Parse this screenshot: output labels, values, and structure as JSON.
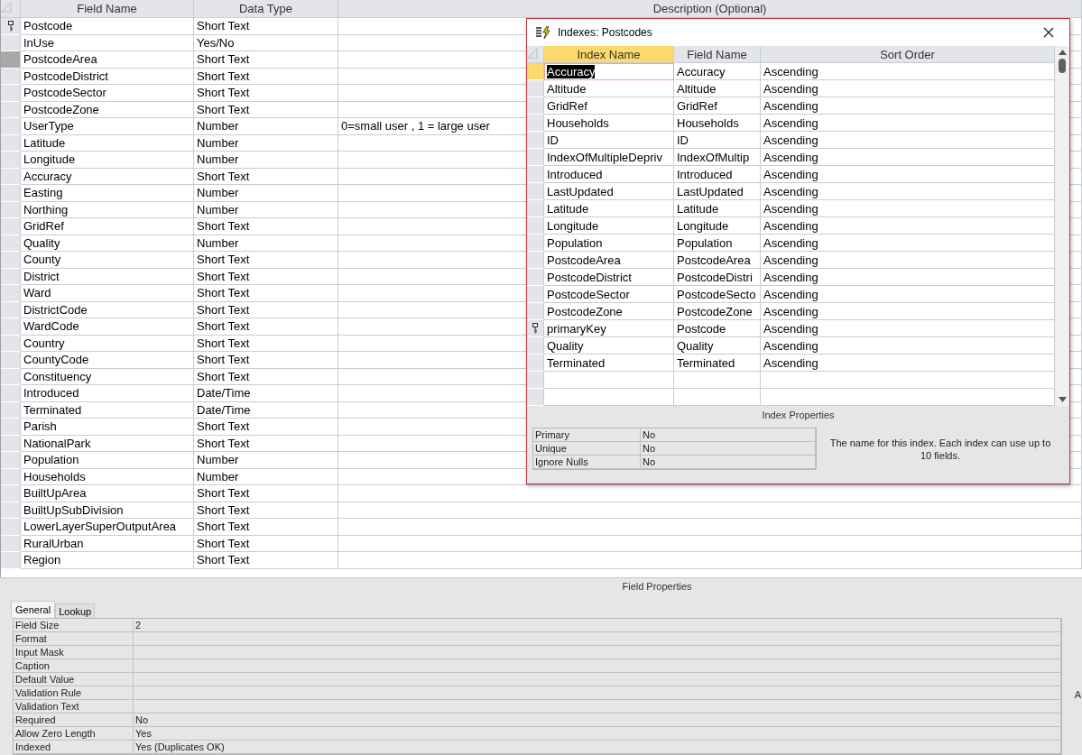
{
  "design_grid": {
    "columns": [
      "Field Name",
      "Data Type",
      "Description (Optional)"
    ],
    "rows": [
      {
        "name": "Postcode",
        "type": "Short Text",
        "description": "",
        "primary_key": true,
        "selected": false
      },
      {
        "name": "InUse",
        "type": "Yes/No",
        "description": "",
        "primary_key": false,
        "selected": false
      },
      {
        "name": "PostcodeArea",
        "type": "Short Text",
        "description": "",
        "primary_key": false,
        "selected": true
      },
      {
        "name": "PostcodeDistrict",
        "type": "Short Text",
        "description": "",
        "primary_key": false,
        "selected": false
      },
      {
        "name": "PostcodeSector",
        "type": "Short Text",
        "description": "",
        "primary_key": false,
        "selected": false
      },
      {
        "name": "PostcodeZone",
        "type": "Short Text",
        "description": "",
        "primary_key": false,
        "selected": false
      },
      {
        "name": "UserType",
        "type": "Number",
        "description": "0=small user ,  1 = large user",
        "primary_key": false,
        "selected": false
      },
      {
        "name": "Latitude",
        "type": "Number",
        "description": "",
        "primary_key": false,
        "selected": false
      },
      {
        "name": "Longitude",
        "type": "Number",
        "description": "",
        "primary_key": false,
        "selected": false
      },
      {
        "name": "Accuracy",
        "type": "Short Text",
        "description": "",
        "primary_key": false,
        "selected": false
      },
      {
        "name": "Easting",
        "type": "Number",
        "description": "",
        "primary_key": false,
        "selected": false
      },
      {
        "name": "Northing",
        "type": "Number",
        "description": "",
        "primary_key": false,
        "selected": false
      },
      {
        "name": "GridRef",
        "type": "Short Text",
        "description": "",
        "primary_key": false,
        "selected": false
      },
      {
        "name": "Quality",
        "type": "Number",
        "description": "",
        "primary_key": false,
        "selected": false
      },
      {
        "name": "County",
        "type": "Short Text",
        "description": "",
        "primary_key": false,
        "selected": false
      },
      {
        "name": "District",
        "type": "Short Text",
        "description": "",
        "primary_key": false,
        "selected": false
      },
      {
        "name": "Ward",
        "type": "Short Text",
        "description": "",
        "primary_key": false,
        "selected": false
      },
      {
        "name": "DistrictCode",
        "type": "Short Text",
        "description": "",
        "primary_key": false,
        "selected": false
      },
      {
        "name": "WardCode",
        "type": "Short Text",
        "description": "",
        "primary_key": false,
        "selected": false
      },
      {
        "name": "Country",
        "type": "Short Text",
        "description": "",
        "primary_key": false,
        "selected": false
      },
      {
        "name": "CountyCode",
        "type": "Short Text",
        "description": "",
        "primary_key": false,
        "selected": false
      },
      {
        "name": "Constituency",
        "type": "Short Text",
        "description": "",
        "primary_key": false,
        "selected": false
      },
      {
        "name": "Introduced",
        "type": "Date/Time",
        "description": "",
        "primary_key": false,
        "selected": false
      },
      {
        "name": "Terminated",
        "type": "Date/Time",
        "description": "",
        "primary_key": false,
        "selected": false
      },
      {
        "name": "Parish",
        "type": "Short Text",
        "description": "",
        "primary_key": false,
        "selected": false
      },
      {
        "name": "NationalPark",
        "type": "Short Text",
        "description": "",
        "primary_key": false,
        "selected": false
      },
      {
        "name": "Population",
        "type": "Number",
        "description": "",
        "primary_key": false,
        "selected": false
      },
      {
        "name": "Households",
        "type": "Number",
        "description": "",
        "primary_key": false,
        "selected": false
      },
      {
        "name": "BuiltUpArea",
        "type": "Short Text",
        "description": "",
        "primary_key": false,
        "selected": false
      },
      {
        "name": "BuiltUpSubDivision",
        "type": "Short Text",
        "description": "",
        "primary_key": false,
        "selected": false
      },
      {
        "name": "LowerLayerSuperOutputArea",
        "type": "Short Text",
        "description": "",
        "primary_key": false,
        "selected": false
      },
      {
        "name": "RuralUrban",
        "type": "Short Text",
        "description": "",
        "primary_key": false,
        "selected": false
      },
      {
        "name": "Region",
        "type": "Short Text",
        "description": "",
        "primary_key": false,
        "selected": false
      }
    ]
  },
  "field_properties": {
    "title": "Field Properties",
    "tabs": [
      {
        "label": "General",
        "selected": true
      },
      {
        "label": "Lookup",
        "selected": false
      }
    ],
    "rows": [
      {
        "label": "Field Size",
        "value": "2"
      },
      {
        "label": "Format",
        "value": ""
      },
      {
        "label": "Input Mask",
        "value": ""
      },
      {
        "label": "Caption",
        "value": ""
      },
      {
        "label": "Default Value",
        "value": ""
      },
      {
        "label": "Validation Rule",
        "value": ""
      },
      {
        "label": "Validation Text",
        "value": ""
      },
      {
        "label": "Required",
        "value": "No"
      },
      {
        "label": "Allow Zero Length",
        "value": "Yes"
      },
      {
        "label": "Indexed",
        "value": "Yes (Duplicates OK)"
      }
    ],
    "help_text": "A"
  },
  "indexes_dialog": {
    "title": "Indexes: Postcodes",
    "columns": [
      "Index Name",
      "Field Name",
      "Sort Order"
    ],
    "rows": [
      {
        "index_name": "Accuracy",
        "field_name": "Accuracy",
        "sort_order": "Ascending",
        "primary_key": false,
        "selected": true
      },
      {
        "index_name": "Altitude",
        "field_name": "Altitude",
        "sort_order": "Ascending",
        "primary_key": false,
        "selected": false
      },
      {
        "index_name": "GridRef",
        "field_name": "GridRef",
        "sort_order": "Ascending",
        "primary_key": false,
        "selected": false
      },
      {
        "index_name": "Households",
        "field_name": "Households",
        "sort_order": "Ascending",
        "primary_key": false,
        "selected": false
      },
      {
        "index_name": "ID",
        "field_name": "ID",
        "sort_order": "Ascending",
        "primary_key": false,
        "selected": false
      },
      {
        "index_name": "IndexOfMultipleDepriv",
        "field_name": "IndexOfMultip",
        "sort_order": "Ascending",
        "primary_key": false,
        "selected": false
      },
      {
        "index_name": "Introduced",
        "field_name": "Introduced",
        "sort_order": "Ascending",
        "primary_key": false,
        "selected": false
      },
      {
        "index_name": "LastUpdated",
        "field_name": "LastUpdated",
        "sort_order": "Ascending",
        "primary_key": false,
        "selected": false
      },
      {
        "index_name": "Latitude",
        "field_name": "Latitude",
        "sort_order": "Ascending",
        "primary_key": false,
        "selected": false
      },
      {
        "index_name": "Longitude",
        "field_name": "Longitude",
        "sort_order": "Ascending",
        "primary_key": false,
        "selected": false
      },
      {
        "index_name": "Population",
        "field_name": "Population",
        "sort_order": "Ascending",
        "primary_key": false,
        "selected": false
      },
      {
        "index_name": "PostcodeArea",
        "field_name": "PostcodeArea",
        "sort_order": "Ascending",
        "primary_key": false,
        "selected": false
      },
      {
        "index_name": "PostcodeDistrict",
        "field_name": "PostcodeDistri",
        "sort_order": "Ascending",
        "primary_key": false,
        "selected": false
      },
      {
        "index_name": "PostcodeSector",
        "field_name": "PostcodeSecto",
        "sort_order": "Ascending",
        "primary_key": false,
        "selected": false
      },
      {
        "index_name": "PostcodeZone",
        "field_name": "PostcodeZone",
        "sort_order": "Ascending",
        "primary_key": false,
        "selected": false
      },
      {
        "index_name": "primaryKey",
        "field_name": "Postcode",
        "sort_order": "Ascending",
        "primary_key": true,
        "selected": false
      },
      {
        "index_name": "Quality",
        "field_name": "Quality",
        "sort_order": "Ascending",
        "primary_key": false,
        "selected": false
      },
      {
        "index_name": "Terminated",
        "field_name": "Terminated",
        "sort_order": "Ascending",
        "primary_key": false,
        "selected": false
      }
    ],
    "properties_title": "Index Properties",
    "properties": [
      {
        "label": "Primary",
        "value": "No"
      },
      {
        "label": "Unique",
        "value": "No"
      },
      {
        "label": "Ignore Nulls",
        "value": "No"
      }
    ],
    "help_text": "The name for this index.  Each index can use up to 10 fields."
  }
}
